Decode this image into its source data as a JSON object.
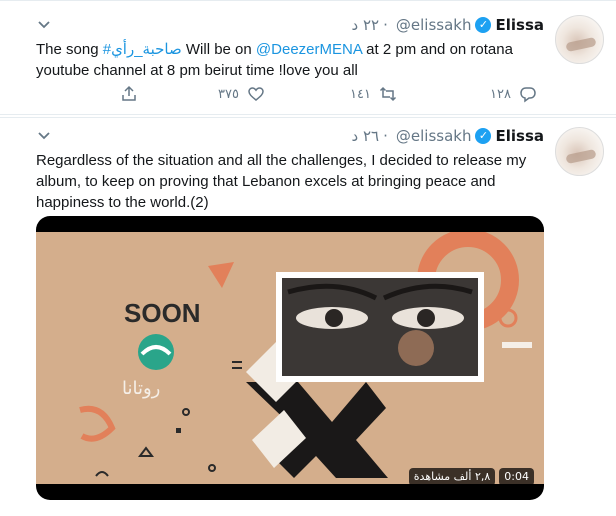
{
  "tweets": [
    {
      "name": "Elissa",
      "handle": "@elissakh",
      "time": "٢٢ د",
      "text": {
        "before": "The song ",
        "hashtag": "#صاحبة_رأي",
        "middle": "  Will be on ",
        "mention": "@DeezerMENA",
        "after": " at 2 pm and on rotana youtube channel at 8 pm beirut time !love you all"
      },
      "actions": {
        "reply_count": "١٢٨",
        "retweet_count": "١٤١",
        "like_count": "٣٧٥"
      }
    },
    {
      "name": "Elissa",
      "handle": "@elissakh",
      "time": "٢٦ د",
      "text": "Regardless of the situation and all the challenges, I decided to release my album, to keep on proving that Lebanon excels at bringing peace and happiness to the world.(2)",
      "video": {
        "soon_label": "SOON",
        "logo_text": "روتانا",
        "duration": "0:04",
        "views": "٢,٨ ألف مشاهدة"
      }
    }
  ],
  "colors": {
    "link": "#1b95e0",
    "verified": "#1da1f2",
    "muted": "#657786",
    "video_bg": "#d4ae8c",
    "rotana_green": "#2aa58a",
    "accent_orange": "#e2805a"
  },
  "icons": {
    "verified": "verified-badge-icon",
    "caret": "chevron-down-icon",
    "reply": "reply-icon",
    "retweet": "retweet-icon",
    "like": "heart-icon",
    "share": "share-icon"
  }
}
